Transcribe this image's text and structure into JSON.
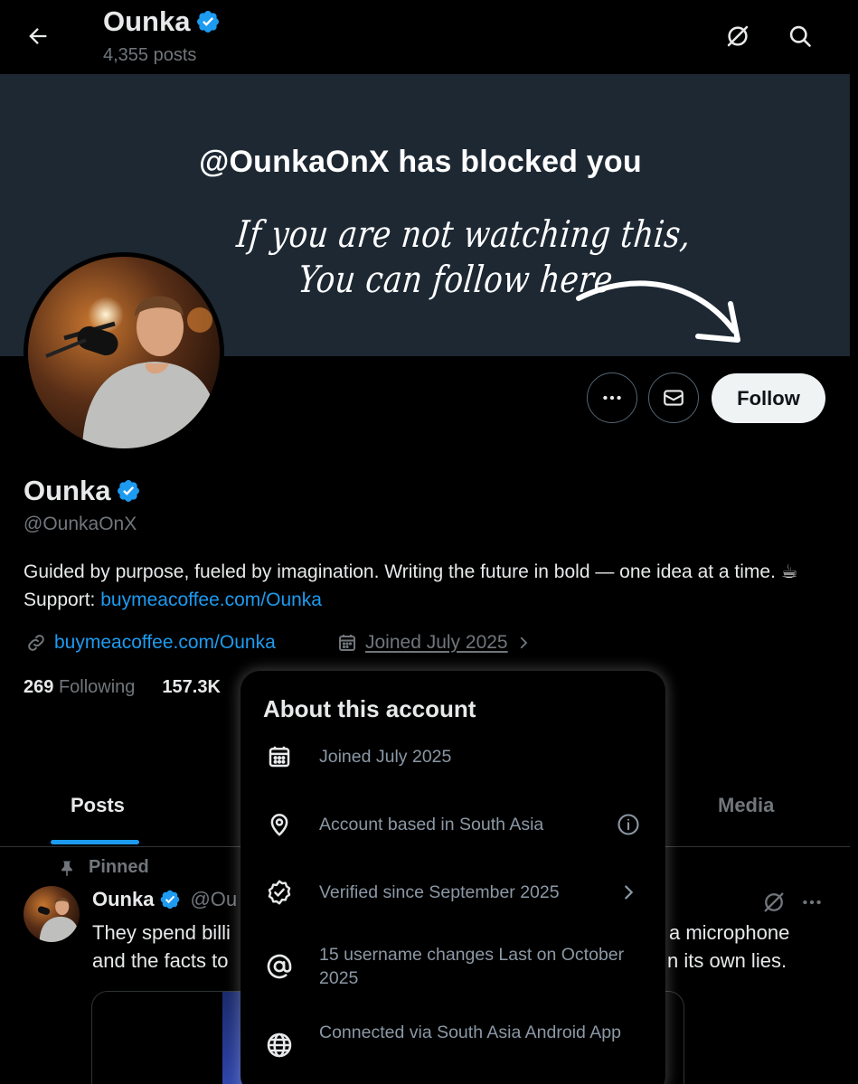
{
  "header": {
    "title": "Ounka",
    "post_count": "4,355 posts",
    "icons": [
      "back-arrow-icon",
      "grok-icon",
      "search-icon"
    ]
  },
  "banner": {
    "headline": "@OunkaOnX has blocked you",
    "script_line1": "If you are not watching this,",
    "script_line2": "You can follow here"
  },
  "actions": {
    "follow_label": "Follow",
    "icons": [
      "more-icon",
      "message-icon"
    ]
  },
  "profile": {
    "name": "Ounka",
    "handle": "@OunkaOnX",
    "bio_text": "Guided by purpose, fueled by imagination. Writing the future in bold — one idea at a time. ☕ Support: ",
    "bio_link": "buymeacoffee.com/Ounka",
    "website": "buymeacoffee.com/Ounka",
    "joined": "Joined July 2025",
    "following_count": "269",
    "following_label": "Following",
    "followers_count": "157.3K"
  },
  "tabs": {
    "posts": "Posts",
    "media": "Media"
  },
  "post": {
    "pinned_label": "Pinned",
    "author": "Ounka",
    "handle_partial": "@Ou",
    "line1_left": "They spend billi",
    "line2_left": "and the facts to",
    "line1_right": "a microphone",
    "line2_right": "n its own lies."
  },
  "popup": {
    "title": "About this account",
    "rows": [
      {
        "icon": "calendar-icon",
        "text": "Joined July 2025"
      },
      {
        "icon": "location-pin-icon",
        "text": "Account based in South Asia"
      },
      {
        "icon": "verified-badge-icon",
        "text": "Verified since September 2025"
      },
      {
        "icon": "at-sign-icon",
        "text": "15 username changes Last on October 2025"
      },
      {
        "icon": "globe-icon",
        "text": "Connected via South Asia Android App"
      }
    ]
  },
  "colors": {
    "background": "#000000",
    "banner": "#1d2833",
    "accent": "#1d9bf0",
    "muted": "#71767b",
    "text": "#e7e9ea"
  }
}
